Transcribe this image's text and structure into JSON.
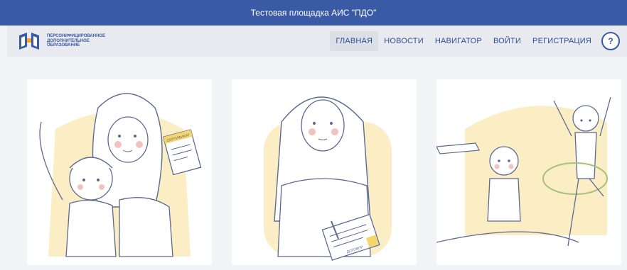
{
  "banner": {
    "text": "Тестовая площадка АИС \"ПДО\""
  },
  "logo": {
    "line1": "ПЕРСОНИФИЦИРОВАННОЕ",
    "line2": "ДОПОЛНИТЕЛЬНОЕ",
    "line3": "ОБРАЗОВАНИЕ"
  },
  "menu": {
    "home": "ГЛАВНАЯ",
    "news": "НОВОСТИ",
    "navigator": "НАВИГАТОР",
    "login": "ВОЙТИ",
    "register": "РЕГИСТРАЦИЯ",
    "help": "?"
  },
  "illustrations": {
    "card1": {
      "document_label": "СЕРТИФИКАТ"
    },
    "card2": {
      "document_label": "ДОГОВОР"
    }
  }
}
